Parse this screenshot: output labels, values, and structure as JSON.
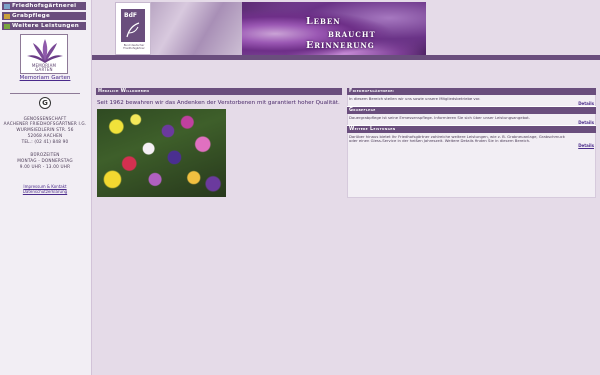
{
  "nav": {
    "items": [
      {
        "label": "Friedhofsgärtnerei"
      },
      {
        "label": "Grabpflege"
      },
      {
        "label": "Weitere Leistungen"
      }
    ]
  },
  "memoriam": {
    "logo_line1": "MEMORIAM",
    "logo_line2": "GARTEN",
    "link": "Memoriam Garten"
  },
  "sidebar": {
    "g_logo": "G",
    "address": {
      "line1": "Genossenschaft",
      "line2": "Aachener Friedhofsgärtner i.G.",
      "line3": "Wurmsiedlerin Str. 56",
      "line4": "52068 Aachen",
      "phone": "Tel.: (02 41) 848 90"
    },
    "hours": {
      "title": "Bürozeiten",
      "days": "Montag - Donnerstag",
      "time": "9.00 Uhr - 13.00 Uhr"
    },
    "links": {
      "impressum": "Impressum & Kontakt",
      "datenschutz": "Datenschutzerklärung"
    }
  },
  "header": {
    "bdf_logo": "BdF",
    "bdf_sub": "Bund deutscher Friedhofsgärtner",
    "slogan": [
      "Leben",
      "braucht",
      "Erinnerung"
    ]
  },
  "welcome": {
    "heading": "Herzlich Willkommen",
    "text": "Seit 1962 bewahren wir das Andenken der Verstorbenen mit garantiert hoher Qualität."
  },
  "panels": [
    {
      "heading": "Friedhofsgärtnerei",
      "text": "In diesem Bereich stellen wir uns sowie unsere Mitgliedsbetriebe vor.",
      "more": "Details"
    },
    {
      "heading": "Grabpflege",
      "text": "Dauergrabpflege ist seine Ermessenspflege. Informieren Sie sich über unser Leistungsangebot.",
      "more": "Details"
    },
    {
      "heading": "Weitere Leistungen",
      "text": "Darüber hinaus bietet Ihr Friedhofsgärtner zahlreiche weitere Leistungen, wie z. B. Grabneuanlage, Grabschmuck",
      "text2": "oder einen Giess-Service in der heißen Jahreszeit. Weitere Details finden Sie in diesem Bereich.",
      "more": "Details"
    }
  ],
  "colors": {
    "accent": "#6a4e7d",
    "background": "#e5dbe8",
    "link": "#4a2a8a"
  }
}
